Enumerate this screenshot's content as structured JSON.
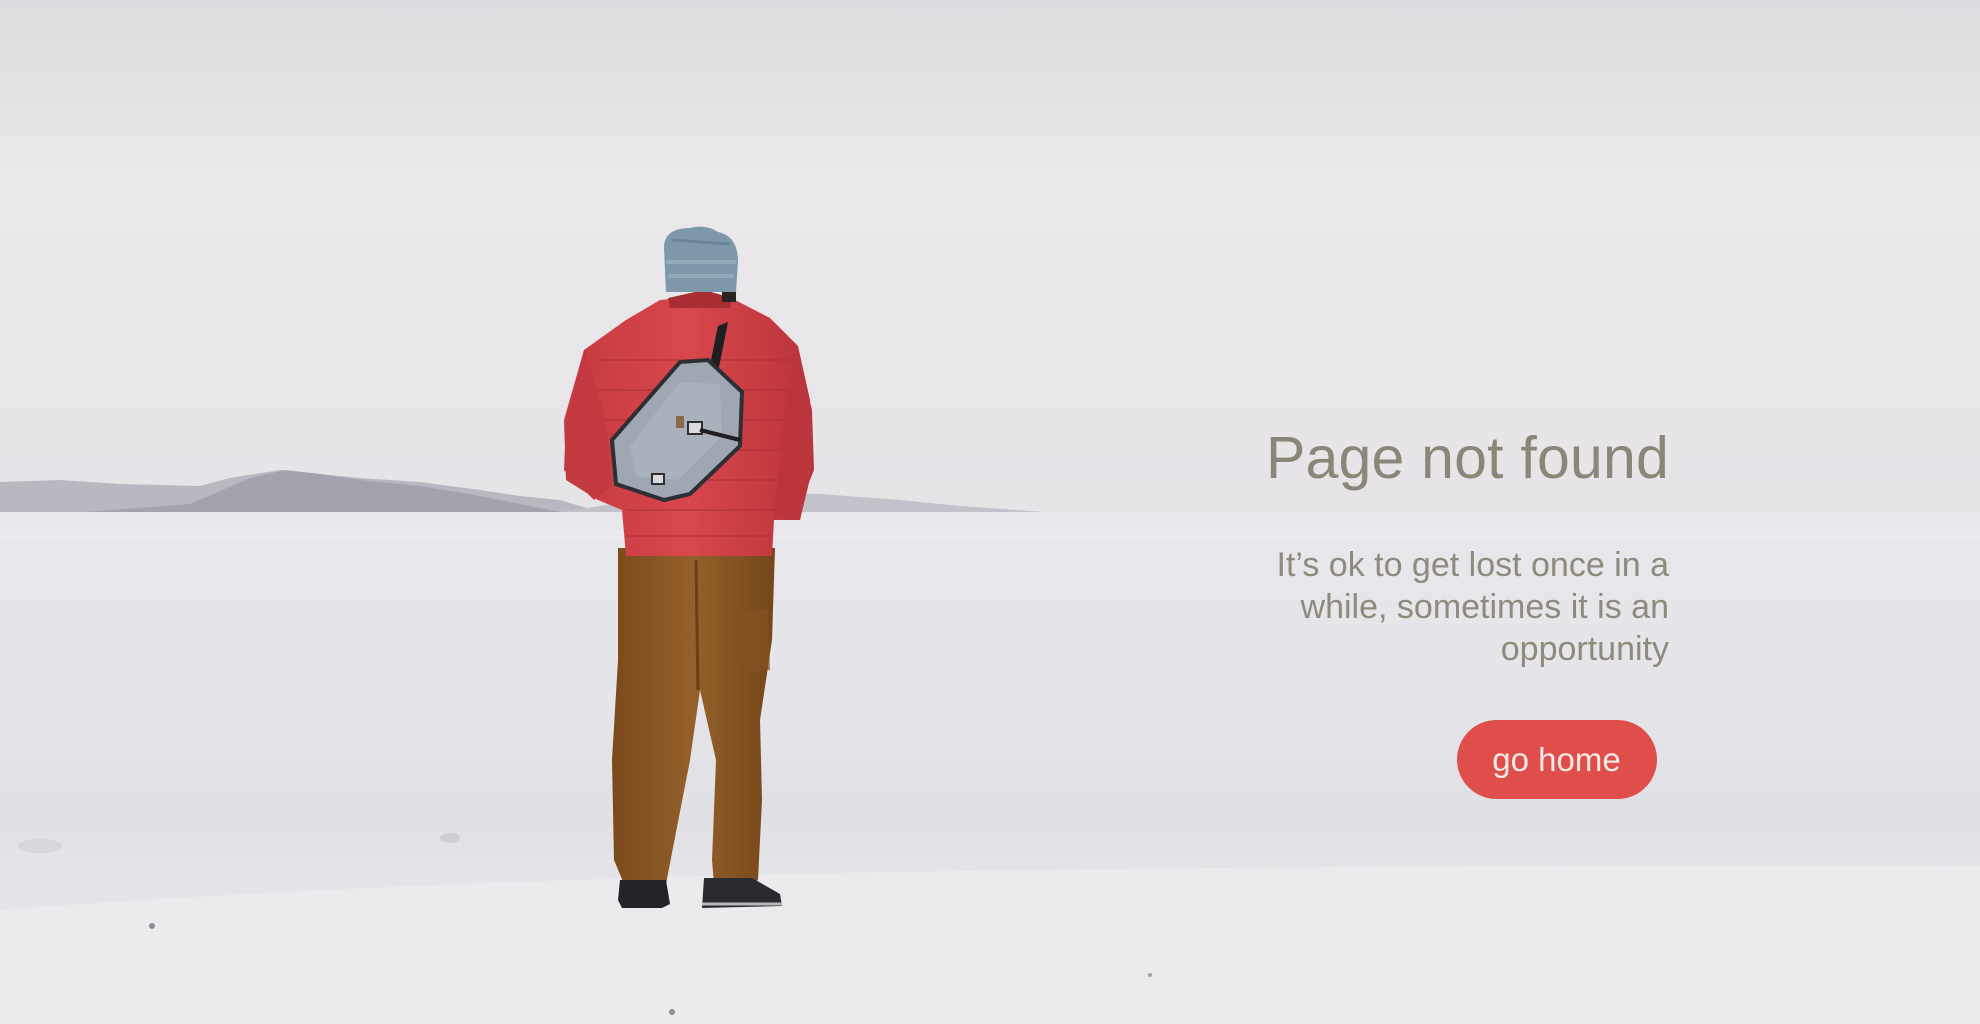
{
  "page": {
    "title": "Page not found",
    "message": "It’s ok to get lost once in a while, sometimes it is an opportunity",
    "home_button_label": "go home"
  },
  "colors": {
    "title_text": "#8b8778",
    "message_text": "#8e8a7c",
    "button_background": "#df4e4a",
    "button_text": "#f7e9e6",
    "sky": "#e9e7e9",
    "ground": "#e7e6e9"
  },
  "background_image": {
    "subject": "person in red puffer jacket and grey sling bag standing on salt flats",
    "icon": "hiker-illustration"
  }
}
